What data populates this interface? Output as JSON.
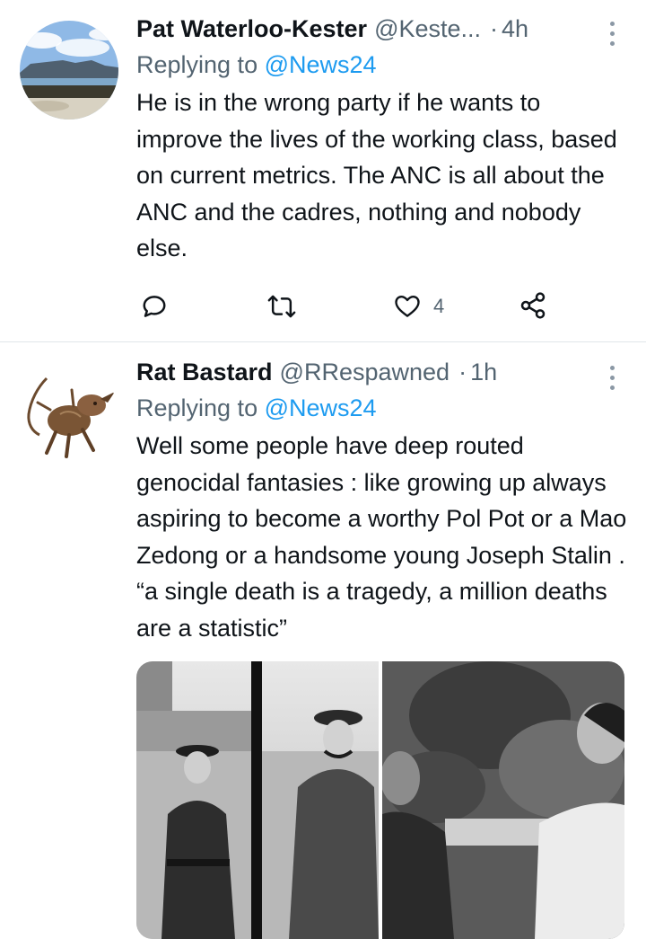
{
  "tweets": [
    {
      "display_name": "Pat Waterloo-Kester",
      "handle": "@Keste...",
      "time": "4h",
      "replying_prefix": "Replying to",
      "replying_to": "@News24",
      "text": "He is in the wrong party if he wants to improve the lives of the working class, based on current metrics. The ANC is all about the ANC and the cadres, nothing and nobody else.",
      "actions": {
        "reply_icon": "reply-icon",
        "retweet_icon": "retweet-icon",
        "like_icon": "heart-icon",
        "like_count": "4",
        "share_icon": "share-icon"
      }
    },
    {
      "display_name": "Rat Bastard",
      "handle": "@RRespawned",
      "time": "1h",
      "replying_prefix": "Replying to",
      "replying_to": "@News24",
      "text": "Well some people have deep routed genocidal fantasies : like growing up always aspiring to become a worthy Pol Pot or a Mao Zedong or a handsome young Joseph Stalin . “a single death is a tragedy, a million deaths are a statistic”"
    }
  ],
  "colors": {
    "link": "#1d9bf0",
    "secondary_text": "#536471",
    "divider": "#e1e6ea"
  }
}
